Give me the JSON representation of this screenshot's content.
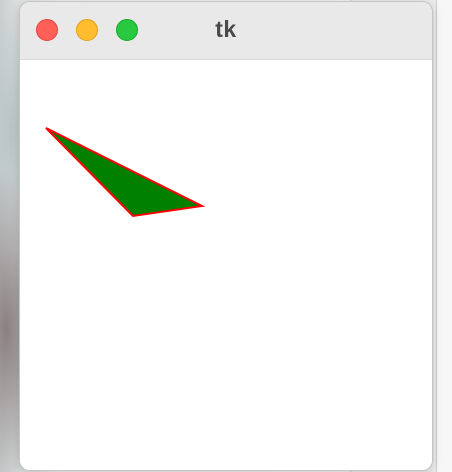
{
  "window": {
    "title": "tk",
    "buttons": {
      "close": "close-button",
      "minimize": "minimize-button",
      "zoom": "zoom-button"
    }
  },
  "canvas": {
    "shapes": [
      {
        "type": "polygon",
        "fill": "#008000",
        "outline": "#ff0000"
      }
    ]
  },
  "colors": {
    "close": "#fe5f57",
    "minimize": "#febc2e",
    "zoom": "#28c840",
    "titlebar": "#e9e9e9",
    "title_text": "#4a4a4a"
  }
}
